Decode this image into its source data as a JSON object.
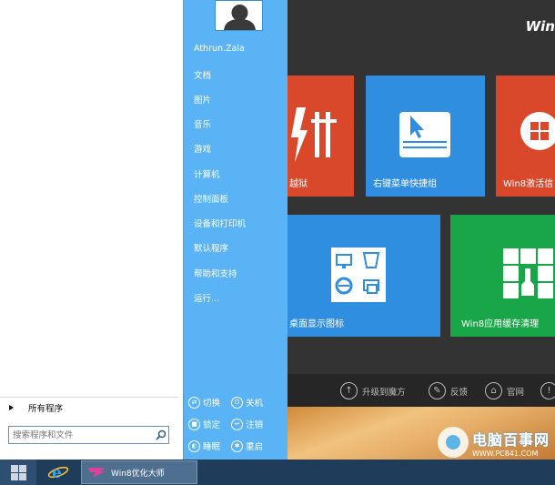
{
  "background_app": {
    "title": "Win",
    "tiles": [
      {
        "label": "越狱",
        "color": "#d9482b"
      },
      {
        "label": "右键菜单快捷组",
        "color": "#2f8ee0"
      },
      {
        "label": "Win8激活信",
        "color": "#d9482b"
      },
      {
        "label": "桌面显示图标",
        "color": "#2f8ee0"
      },
      {
        "label": "Win8应用缓存清理",
        "color": "#18a648"
      }
    ],
    "bottom_bar": [
      {
        "label": "升级到魔方",
        "icon": "up-arrow-icon"
      },
      {
        "label": "反馈",
        "icon": "pencil-icon"
      },
      {
        "label": "官网",
        "icon": "home-icon"
      }
    ],
    "watermark": {
      "main": "电脑百事网",
      "url": "WWW.PC841.COM"
    }
  },
  "start_menu": {
    "all_programs": "所有程序",
    "search_placeholder": "搜索程序和文件",
    "user_name": "Athrun.Zala",
    "links": [
      "文档",
      "图片",
      "音乐",
      "游戏",
      "计算机",
      "控制面板",
      "设备和打印机",
      "默认程序",
      "帮助和支持",
      "运行..."
    ],
    "power": {
      "switch": "切换",
      "shutdown": "关机",
      "lock": "锁定",
      "logoff": "注销",
      "sleep": "睡眠",
      "restart": "重启"
    }
  },
  "taskbar": {
    "app_label": "Win8优化大师"
  },
  "colors": {
    "start_right_panel": "#59b3f5",
    "taskbar": "#1f3c5a",
    "tile_red": "#d9482b",
    "tile_blue": "#2f8ee0",
    "tile_green": "#18a648"
  }
}
